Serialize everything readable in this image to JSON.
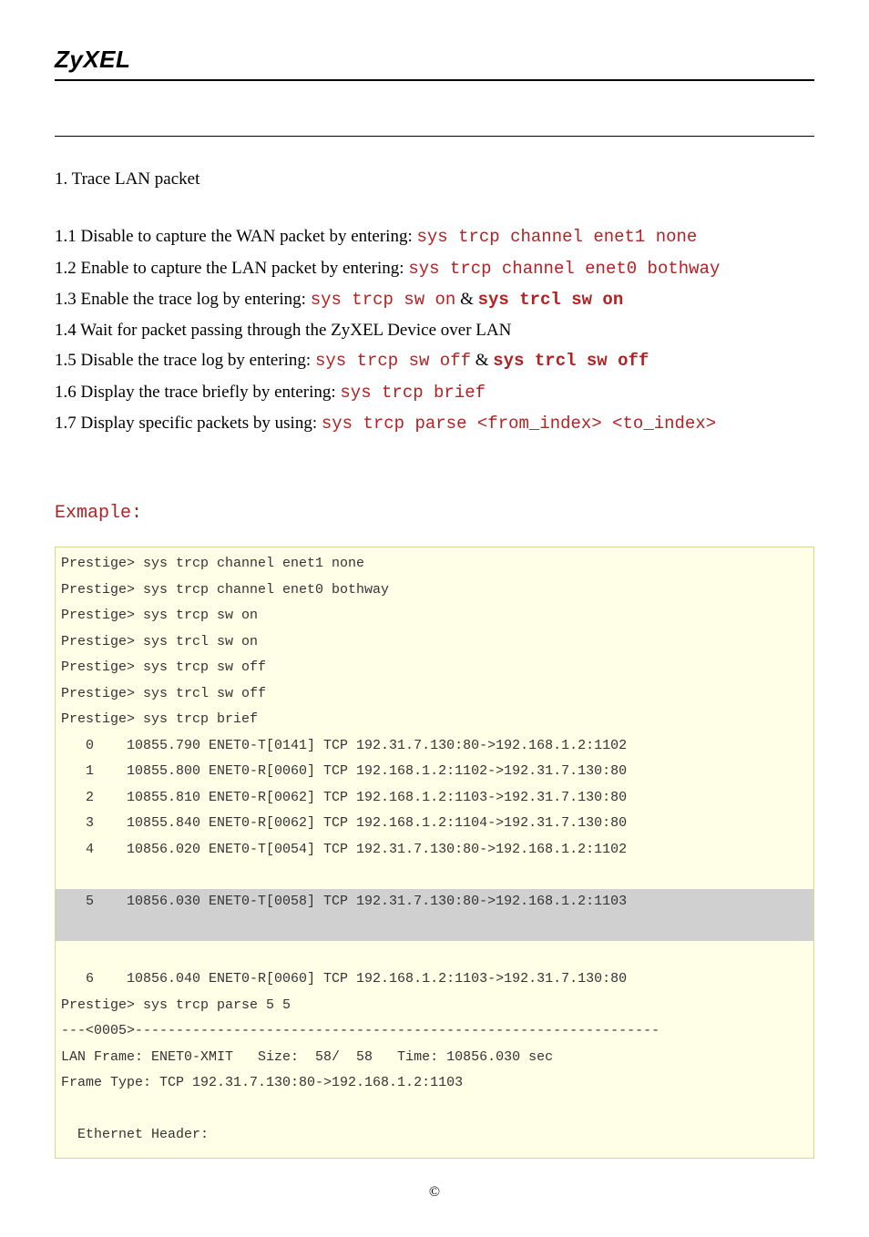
{
  "logo": "ZyXEL",
  "section": {
    "title": "1. Trace LAN packet",
    "steps": [
      {
        "num": "1.1",
        "pre": "Disable to capture the WAN packet by entering: ",
        "cmd": "sys trcp channel enet1 none"
      },
      {
        "num": "1.2",
        "pre": "Enable to capture the LAN packet by entering: ",
        "cmd": "sys trcp channel enet0 bothway"
      },
      {
        "num": "1.3",
        "pre": "Enable the trace log by entering: ",
        "cmd": "sys trcp sw on",
        "amp": " & ",
        "cmd2": "sys trcl sw on"
      },
      {
        "num": "1.4",
        "pre": "Wait for packet passing through the ZyXEL Device over LAN"
      },
      {
        "num": "1.5",
        "pre": "Disable the trace log by entering: ",
        "cmd": "sys trcp sw off",
        "amp": " & ",
        "cmd2": "sys trcl sw off"
      },
      {
        "num": "1.6",
        "pre": "Display the trace briefly by entering: ",
        "cmd": "sys trcp brief"
      },
      {
        "num": "1.7",
        "pre": "Display specific packets by using: ",
        "cmd": "sys trcp parse <from_index> <to_index>"
      }
    ]
  },
  "example_heading": "Exmaple:",
  "terminal": {
    "lines_top": [
      "Prestige> sys trcp channel enet1 none",
      "Prestige> sys trcp channel enet0 bothway",
      "Prestige> sys trcp sw on",
      "Prestige> sys trcl sw on",
      "Prestige> sys trcp sw off",
      "Prestige> sys trcl sw off",
      "Prestige> sys trcp brief",
      "   0    10855.790 ENET0-T[0141] TCP 192.31.7.130:80->192.168.1.2:1102",
      "   1    10855.800 ENET0-R[0060] TCP 192.168.1.2:1102->192.31.7.130:80",
      "   2    10855.810 ENET0-R[0062] TCP 192.168.1.2:1103->192.31.7.130:80",
      "   3    10855.840 ENET0-R[0062] TCP 192.168.1.2:1104->192.31.7.130:80",
      "   4    10856.020 ENET0-T[0054] TCP 192.31.7.130:80->192.168.1.2:1102",
      ""
    ],
    "highlight": [
      "   5    10856.030 ENET0-T[0058] TCP 192.31.7.130:80->192.168.1.2:1103",
      ""
    ],
    "lines_bottom": [
      "",
      "   6    10856.040 ENET0-R[0060] TCP 192.168.1.2:1103->192.31.7.130:80",
      "Prestige> sys trcp parse 5 5",
      "---<0005>----------------------------------------------------------------",
      "LAN Frame: ENET0-XMIT   Size:  58/  58   Time: 10856.030 sec",
      "Frame Type: TCP 192.31.7.130:80->192.168.1.2:1103",
      "",
      "  Ethernet Header:"
    ]
  },
  "copyright": "©"
}
